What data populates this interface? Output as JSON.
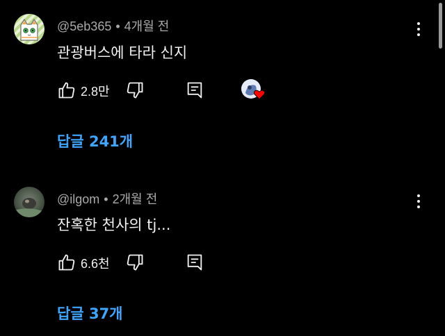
{
  "comments": [
    {
      "author": "@5eb365",
      "separator": "•",
      "time": "4개월 전",
      "text": "관광버스에 타라 신지",
      "likes": "2.8만",
      "replies": "답글 241개",
      "avatar_icon": "cat-avatar-icon",
      "has_creator_heart": true
    },
    {
      "author": "@ilgom",
      "separator": "•",
      "time": "2개월 전",
      "text": "잔혹한 천사의 tj...",
      "likes": "6.6천",
      "replies": "답글 37개",
      "avatar_icon": "photo-avatar",
      "has_creator_heart": false
    }
  ],
  "colors": {
    "background": "#000000",
    "text": "#f1f1f1",
    "meta": "#aaaaaa",
    "link": "#3ea6ff",
    "heart": "#ff0000"
  }
}
